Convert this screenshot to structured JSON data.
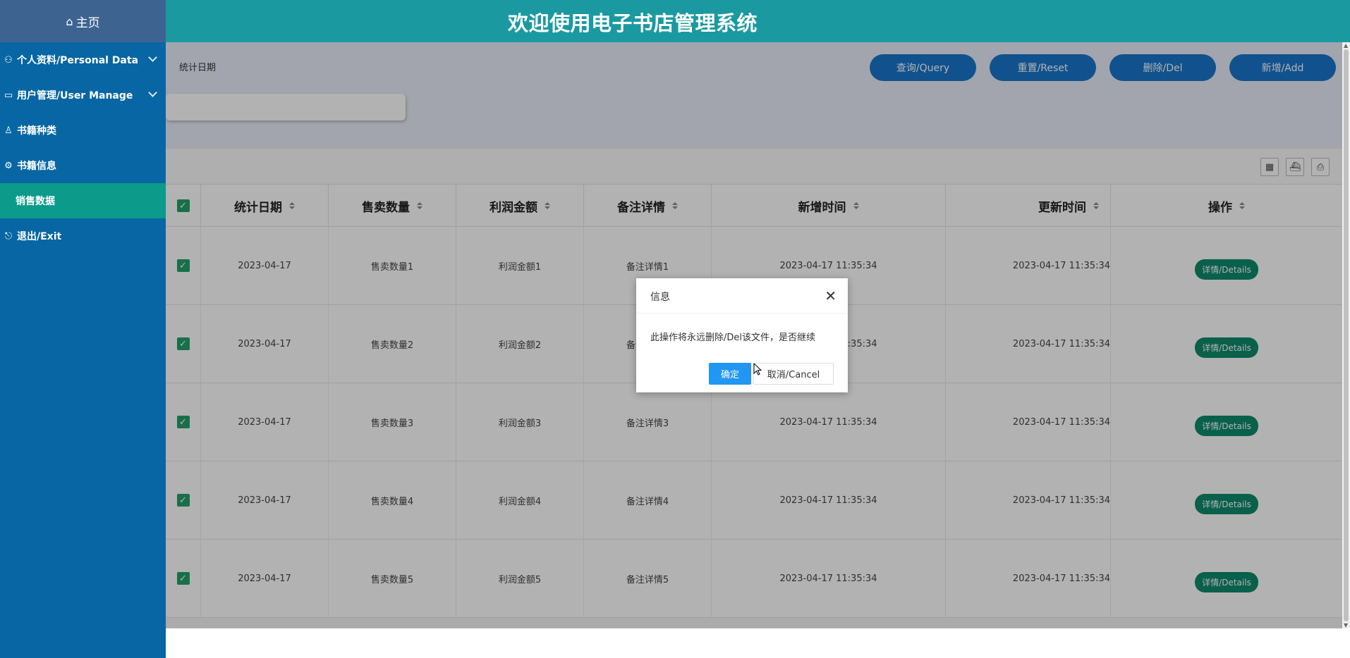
{
  "sidebar": {
    "home": "主页",
    "items": [
      {
        "label": "个人资料/Personal Data",
        "icon": "user-card-icon",
        "has_chevron": true
      },
      {
        "label": "用户管理/User Manage",
        "icon": "monitor-icon",
        "has_chevron": true
      },
      {
        "label": "书籍种类",
        "icon": "person-icon",
        "has_chevron": false
      },
      {
        "label": "书籍信息",
        "icon": "settings-card-icon",
        "has_chevron": false
      },
      {
        "label": "销售数据",
        "icon": "",
        "has_chevron": false,
        "active": true
      },
      {
        "label": "退出/Exit",
        "icon": "exit-icon",
        "has_chevron": false
      }
    ]
  },
  "header": {
    "title": "欢迎使用电子书店管理系统"
  },
  "filter": {
    "label": "统计日期",
    "placeholder": ""
  },
  "buttons": {
    "query": "查询/Query",
    "reset": "重置/Reset",
    "delete": "删除/Del",
    "add": "新增/Add"
  },
  "table": {
    "columns": [
      "统计日期",
      "售卖数量",
      "利润金额",
      "备注详情",
      "新增时间",
      "更新时间",
      "操作"
    ],
    "rows": [
      {
        "date": "2023-04-17",
        "qty": "售卖数量1",
        "profit": "利润金额1",
        "note": "备注详情1",
        "created": "2023-04-17 11:35:34",
        "updated": "2023-04-17 11:35:34",
        "action": "详情/Details"
      },
      {
        "date": "2023-04-17",
        "qty": "售卖数量2",
        "profit": "利润金额2",
        "note": "备注详情2",
        "created": "2023-04-17 11:35:34",
        "updated": "2023-04-17 11:35:34",
        "action": "详情/Details"
      },
      {
        "date": "2023-04-17",
        "qty": "售卖数量3",
        "profit": "利润金额3",
        "note": "备注详情3",
        "created": "2023-04-17 11:35:34",
        "updated": "2023-04-17 11:35:34",
        "action": "详情/Details"
      },
      {
        "date": "2023-04-17",
        "qty": "售卖数量4",
        "profit": "利润金额4",
        "note": "备注详情4",
        "created": "2023-04-17 11:35:34",
        "updated": "2023-04-17 11:35:34",
        "action": "详情/Details"
      },
      {
        "date": "2023-04-17",
        "qty": "售卖数量5",
        "profit": "利润金额5",
        "note": "备注详情5",
        "created": "2023-04-17 11:35:34",
        "updated": "2023-04-17 11:35:34",
        "action": "详情/Details"
      }
    ]
  },
  "dialog": {
    "title": "信息",
    "message": "此操作将永远删除/Del该文件，是否继续",
    "ok": "确定",
    "cancel": "取消/Cancel"
  }
}
